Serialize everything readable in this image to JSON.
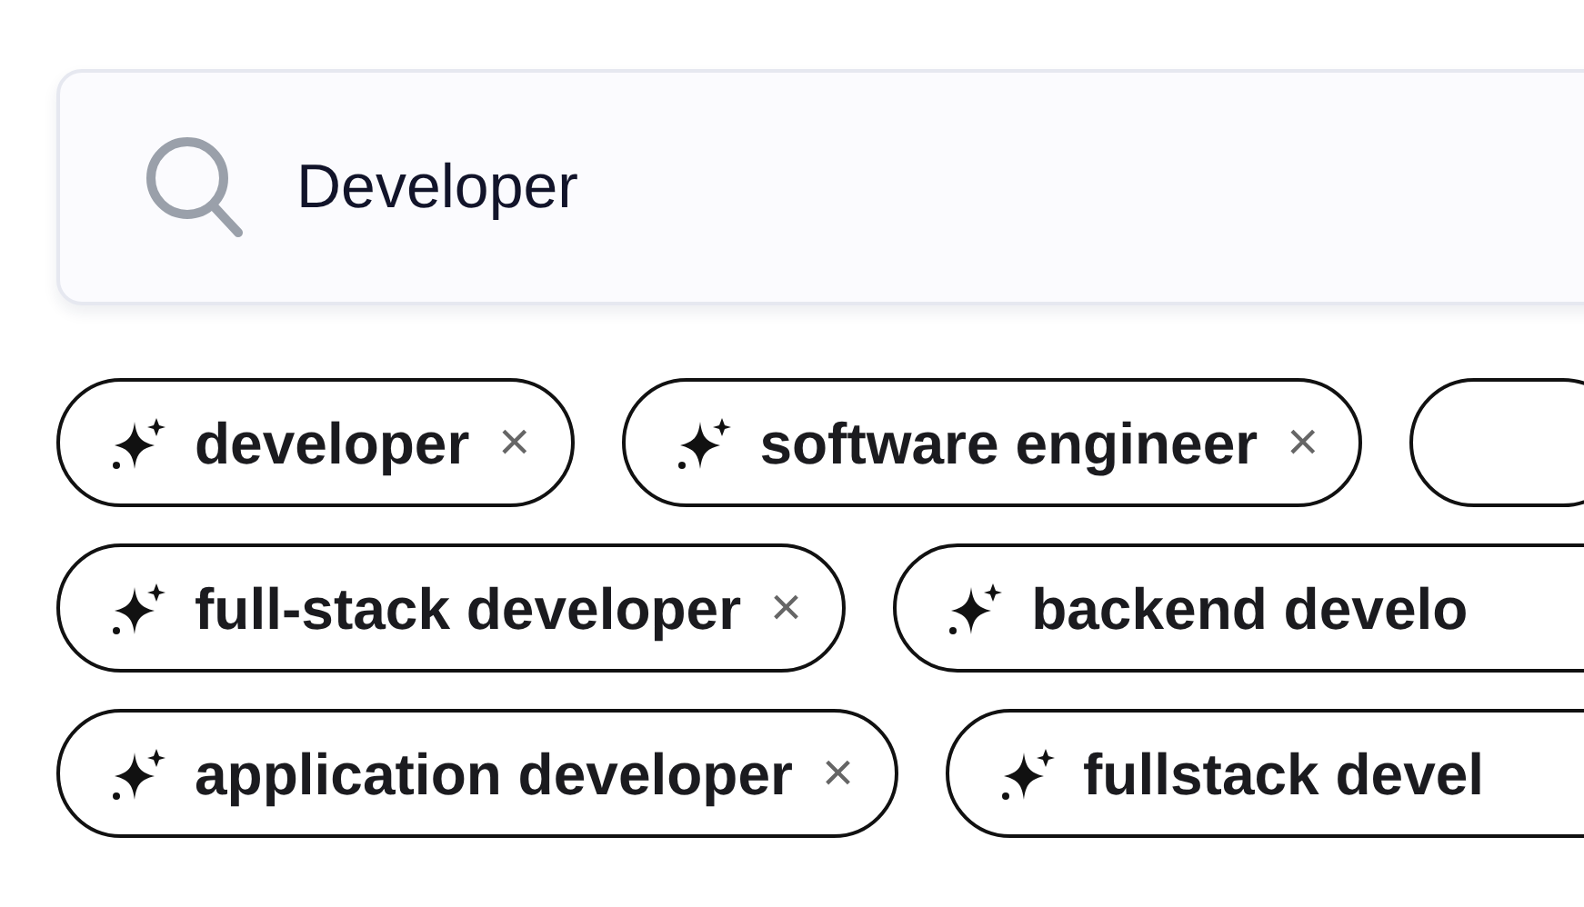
{
  "search": {
    "value": "Developer"
  },
  "chip_rows": [
    [
      {
        "kind": "keyword",
        "label": "developer",
        "remove": "×"
      },
      {
        "kind": "keyword",
        "label": "software engineer",
        "remove": "×"
      },
      {
        "kind": "edge"
      }
    ],
    [
      {
        "kind": "keyword",
        "label": "full-stack developer",
        "remove": "×"
      },
      {
        "kind": "keyword",
        "label": "backend develo"
      }
    ],
    [
      {
        "kind": "keyword",
        "label": "application developer",
        "remove": "×"
      },
      {
        "kind": "keyword",
        "label": "fullstack devel"
      }
    ]
  ]
}
